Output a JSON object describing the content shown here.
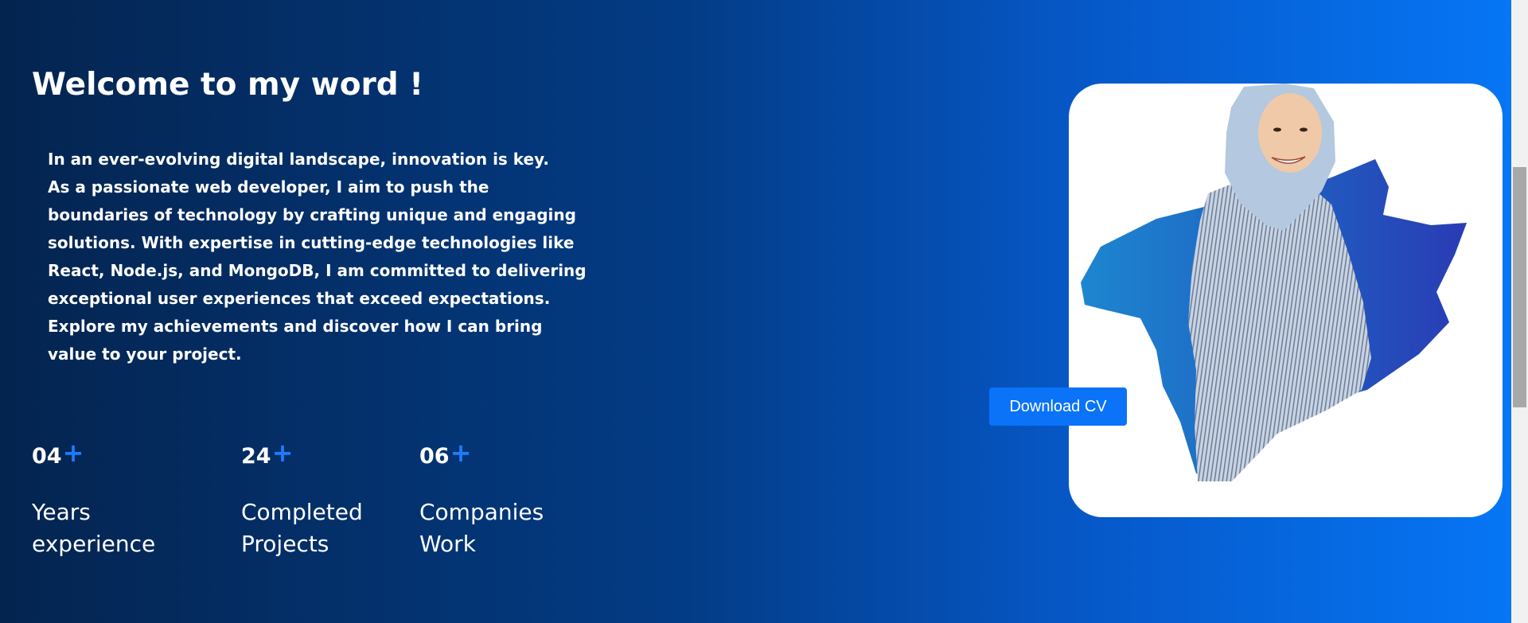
{
  "hero": {
    "title": "Welcome to my word !",
    "intro_line1": "In an ever-evolving digital landscape, innovation is key.",
    "intro_line2": "As a passionate web developer, I aim to push the boundaries of technology by crafting unique and engaging solutions. With expertise in cutting-edge technologies like React, Node.js, and MongoDB, I am committed to delivering exceptional user experiences that exceed expectations. Explore my achievements and discover how I can bring value to your project."
  },
  "stats": [
    {
      "number": "04",
      "plus": "+",
      "label_line1": "Years",
      "label_line2": "experience"
    },
    {
      "number": "24",
      "plus": "+",
      "label_line1": "Completed",
      "label_line2": "Projects"
    },
    {
      "number": "06",
      "plus": "+",
      "label_line1": "Companies",
      "label_line2": "Work"
    }
  ],
  "download_button": {
    "label": "Download CV"
  },
  "colors": {
    "background_start": "#04244f",
    "background_end": "#0677f7",
    "accent": "#1e7bff",
    "button": "#0a73f8"
  },
  "icons": {
    "stat_suffix": "plus-icon"
  }
}
